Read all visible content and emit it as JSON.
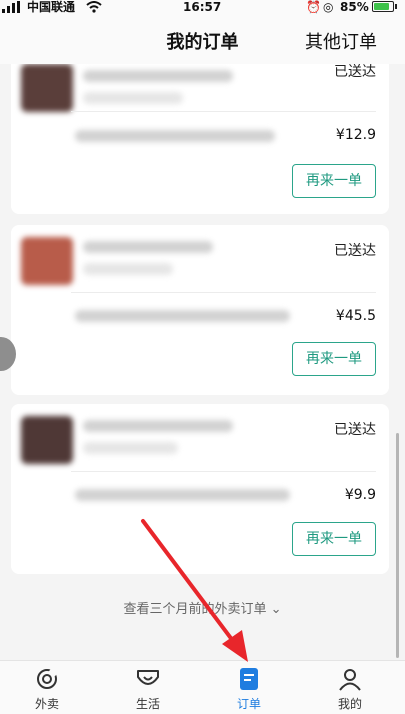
{
  "status_bar": {
    "carrier": "中国联通",
    "time": "16:57",
    "battery": "85%"
  },
  "header": {
    "title": "我的订单",
    "other_orders": "其他订单"
  },
  "orders": [
    {
      "status": "已送达",
      "price": "¥12.9",
      "reorder_label": "再来一单"
    },
    {
      "status": "已送达",
      "price": "¥45.5",
      "reorder_label": "再来一单"
    },
    {
      "status": "已送达",
      "price": "¥9.9",
      "reorder_label": "再来一单"
    }
  ],
  "more_link": "查看三个月前的外卖订单 ⌄",
  "tabs": [
    {
      "label": "外卖",
      "icon": "takeout-icon",
      "active": false
    },
    {
      "label": "生活",
      "icon": "life-icon",
      "active": false
    },
    {
      "label": "订单",
      "icon": "order-icon",
      "active": true
    },
    {
      "label": "我的",
      "icon": "profile-icon",
      "active": false
    }
  ],
  "colors": {
    "accent_green": "#1f9a80",
    "active_tab": "#1f7de0",
    "annotation_arrow": "#e8262b"
  }
}
